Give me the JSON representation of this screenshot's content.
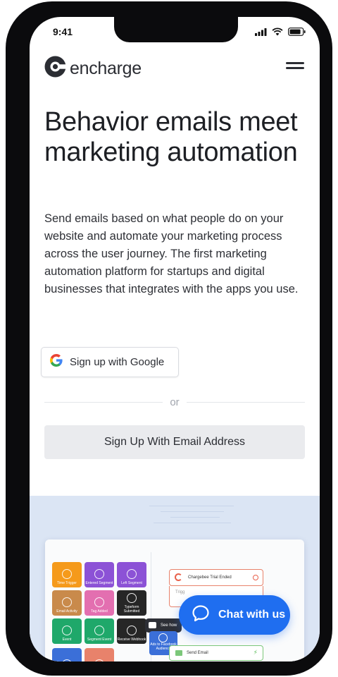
{
  "status_bar": {
    "time": "9:41"
  },
  "header": {
    "logo_text": "encharge"
  },
  "hero": {
    "title": "Behavior emails meet marketing automation",
    "description": "Send emails based on what people do on your website and automate your marketing process across the user journey. The first marketing automation platform for startups and digital businesses that integrates with the apps you use."
  },
  "signup": {
    "google_label": "Sign up with Google",
    "or_label": "or",
    "email_label": "Sign Up With Email Address"
  },
  "preview": {
    "tiles": [
      {
        "label": "Time Trigger",
        "color": "#f59a1b"
      },
      {
        "label": "Entered Segment",
        "color": "#8c52d6"
      },
      {
        "label": "Left Segment",
        "color": "#8c52d6"
      },
      {
        "label": "Email Activity",
        "color": "#c98a4b"
      },
      {
        "label": "Tag Added",
        "color": "#e36fb0"
      },
      {
        "label": "Typeform Submitted",
        "color": "#262626"
      },
      {
        "label": "Event",
        "color": "#1fa86a"
      },
      {
        "label": "Segment Event",
        "color": "#1fa86a"
      },
      {
        "label": "Receive Webhook",
        "color": "#262626"
      }
    ],
    "flow_trigger_title": "Chargebee Trial Ended",
    "flow_trigger_sub": "Trigg",
    "see_how": "See how",
    "fb_label": "Ads to Facebook Audience",
    "send_email": "Send Email"
  },
  "chat": {
    "label": "Chat with us"
  },
  "colors": {
    "accent": "#1f6ef0",
    "preview_bg": "#dbe5f4",
    "text": "#1d1f24"
  }
}
